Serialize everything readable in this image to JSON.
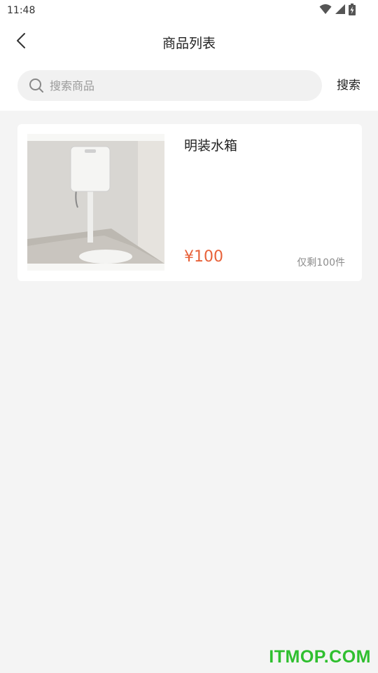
{
  "status_bar": {
    "time": "11:48",
    "icons": [
      "wifi-icon",
      "cellular-signal-icon",
      "battery-charging-icon"
    ]
  },
  "header": {
    "back_icon": "chevron-left-icon",
    "title": "商品列表"
  },
  "search": {
    "icon": "search-icon",
    "placeholder": "搜索商品",
    "value": "",
    "button_label": "搜索"
  },
  "products": [
    {
      "name": "明装水箱",
      "price": "¥100",
      "stock": "仅剩100件"
    }
  ],
  "watermark": "ITMOP.COM",
  "colors": {
    "accent": "#e8623a",
    "page_bg": "#f4f4f4",
    "search_bg": "#f1f1f1",
    "watermark": "#2fbf2f"
  }
}
